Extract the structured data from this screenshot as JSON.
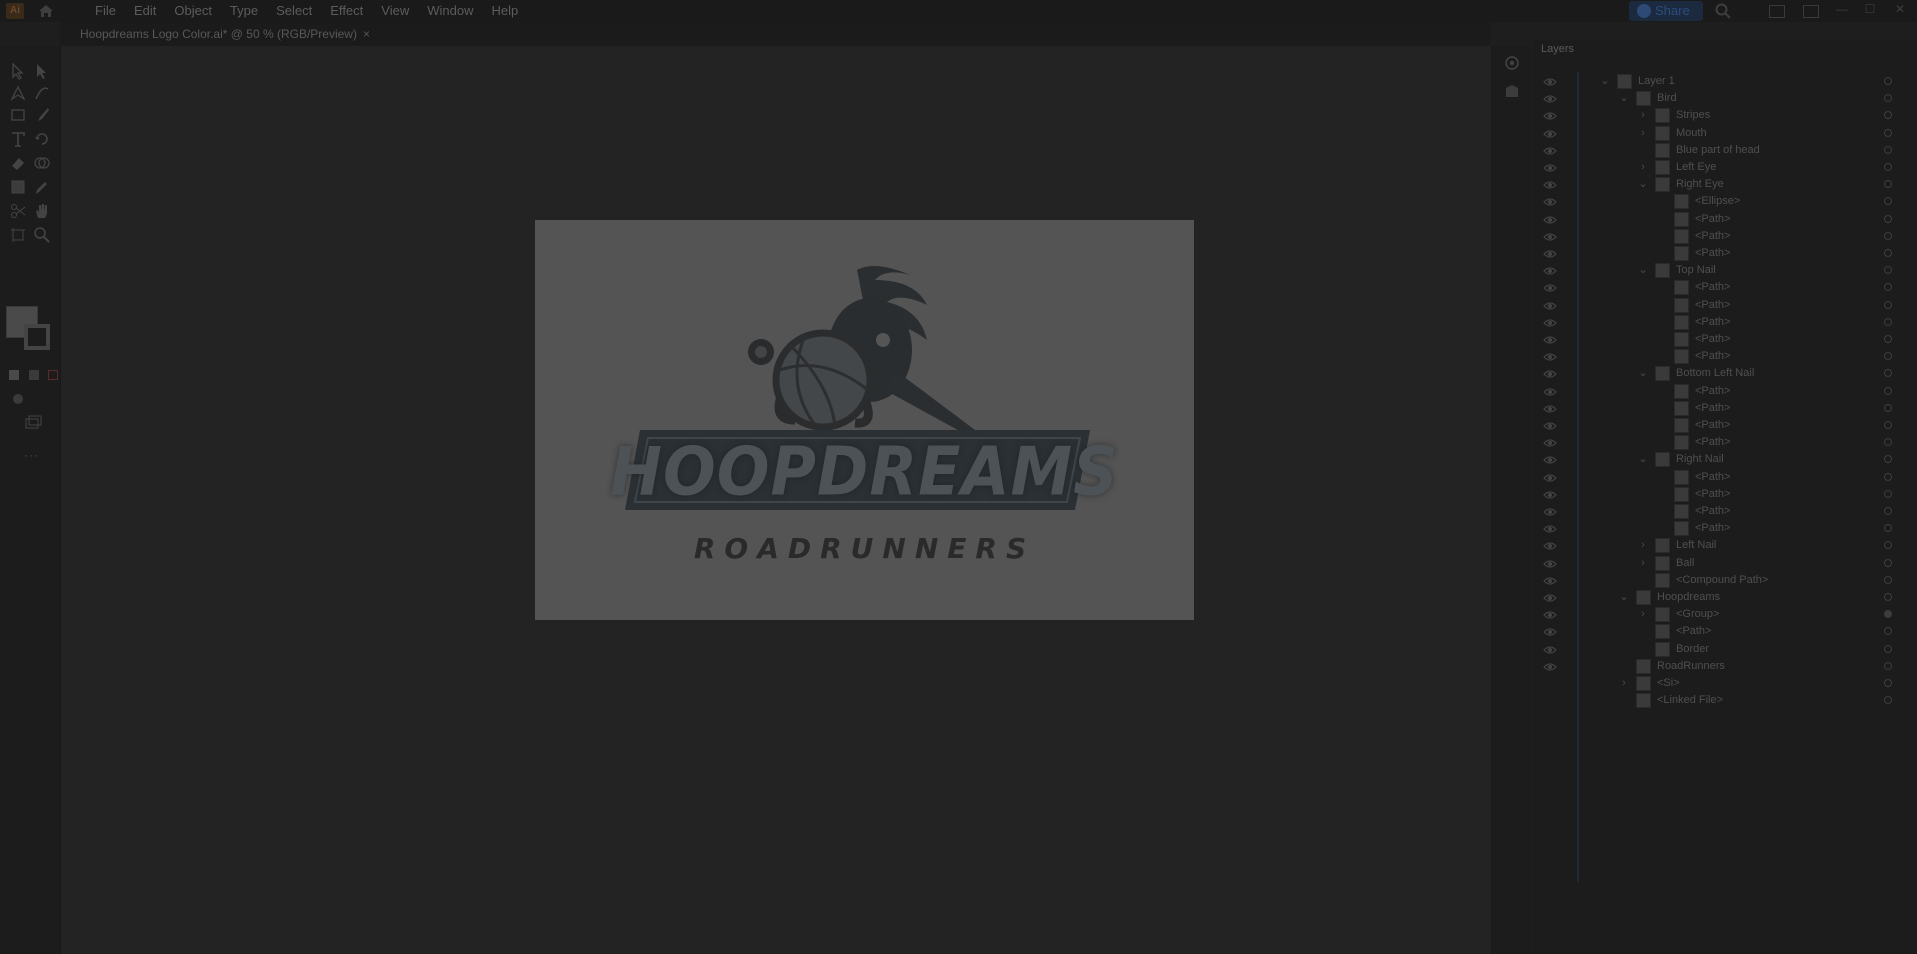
{
  "app": {
    "logo_text": "Ai"
  },
  "menu": [
    "File",
    "Edit",
    "Object",
    "Type",
    "Select",
    "Effect",
    "View",
    "Window",
    "Help"
  ],
  "share_label": "Share",
  "window_controls": [
    "—",
    "☐",
    "✕"
  ],
  "document": {
    "tab_title": "Hoopdreams Logo Color.ai* @ 50 % (RGB/Preview)",
    "close": "×"
  },
  "toolbar": {
    "more": "···"
  },
  "artwork": {
    "title": "HOOPDREAMS",
    "subtitle": "ROADRUNNERS"
  },
  "layers_panel": {
    "title": "Layers",
    "rows": [
      {
        "name": "Layer 1",
        "indent": 0,
        "chevron": "down",
        "target": "hollow"
      },
      {
        "name": "Bird",
        "indent": 1,
        "chevron": "down",
        "target": "hollow"
      },
      {
        "name": "Stripes",
        "indent": 2,
        "chevron": "right",
        "target": "hollow"
      },
      {
        "name": "Mouth",
        "indent": 2,
        "chevron": "right",
        "target": "hollow"
      },
      {
        "name": "Blue part of head",
        "indent": 2,
        "chevron": "none",
        "target": "hollow"
      },
      {
        "name": "Left Eye",
        "indent": 2,
        "chevron": "right",
        "target": "hollow"
      },
      {
        "name": "Right Eye",
        "indent": 2,
        "chevron": "down",
        "target": "hollow"
      },
      {
        "name": "<Ellipse>",
        "indent": 3,
        "chevron": "none",
        "target": "hollow"
      },
      {
        "name": "<Path>",
        "indent": 3,
        "chevron": "none",
        "target": "hollow"
      },
      {
        "name": "<Path>",
        "indent": 3,
        "chevron": "none",
        "target": "hollow"
      },
      {
        "name": "<Path>",
        "indent": 3,
        "chevron": "none",
        "target": "hollow"
      },
      {
        "name": "Top Nail",
        "indent": 2,
        "chevron": "down",
        "target": "hollow"
      },
      {
        "name": "<Path>",
        "indent": 3,
        "chevron": "none",
        "target": "hollow"
      },
      {
        "name": "<Path>",
        "indent": 3,
        "chevron": "none",
        "target": "hollow"
      },
      {
        "name": "<Path>",
        "indent": 3,
        "chevron": "none",
        "target": "hollow"
      },
      {
        "name": "<Path>",
        "indent": 3,
        "chevron": "none",
        "target": "hollow"
      },
      {
        "name": "<Path>",
        "indent": 3,
        "chevron": "none",
        "target": "hollow"
      },
      {
        "name": "Bottom Left Nail",
        "indent": 2,
        "chevron": "down",
        "target": "hollow"
      },
      {
        "name": "<Path>",
        "indent": 3,
        "chevron": "none",
        "target": "hollow"
      },
      {
        "name": "<Path>",
        "indent": 3,
        "chevron": "none",
        "target": "hollow"
      },
      {
        "name": "<Path>",
        "indent": 3,
        "chevron": "none",
        "target": "hollow"
      },
      {
        "name": "<Path>",
        "indent": 3,
        "chevron": "none",
        "target": "hollow"
      },
      {
        "name": "Right Nail",
        "indent": 2,
        "chevron": "down",
        "target": "hollow"
      },
      {
        "name": "<Path>",
        "indent": 3,
        "chevron": "none",
        "target": "hollow"
      },
      {
        "name": "<Path>",
        "indent": 3,
        "chevron": "none",
        "target": "hollow"
      },
      {
        "name": "<Path>",
        "indent": 3,
        "chevron": "none",
        "target": "hollow"
      },
      {
        "name": "<Path>",
        "indent": 3,
        "chevron": "none",
        "target": "hollow"
      },
      {
        "name": "Left Nail",
        "indent": 2,
        "chevron": "right",
        "target": "hollow"
      },
      {
        "name": "Ball",
        "indent": 2,
        "chevron": "right",
        "target": "hollow"
      },
      {
        "name": "<Compound Path>",
        "indent": 2,
        "chevron": "none",
        "target": "hollow"
      },
      {
        "name": "Hoopdreams",
        "indent": 1,
        "chevron": "down",
        "target": "hollow"
      },
      {
        "name": "<Group>",
        "indent": 2,
        "chevron": "right",
        "target": "filled"
      },
      {
        "name": "<Path>",
        "indent": 2,
        "chevron": "none",
        "target": "hollow"
      },
      {
        "name": "Border",
        "indent": 2,
        "chevron": "none",
        "target": "hollow"
      },
      {
        "name": "RoadRunners",
        "indent": 1,
        "chevron": "none",
        "target": "hollow"
      },
      {
        "name": "<Si>",
        "indent": 1,
        "chevron": "right",
        "target": "hollow",
        "no_eye": true
      },
      {
        "name": "<Linked File>",
        "indent": 1,
        "chevron": "none",
        "target": "hollow",
        "no_eye": true
      }
    ]
  }
}
